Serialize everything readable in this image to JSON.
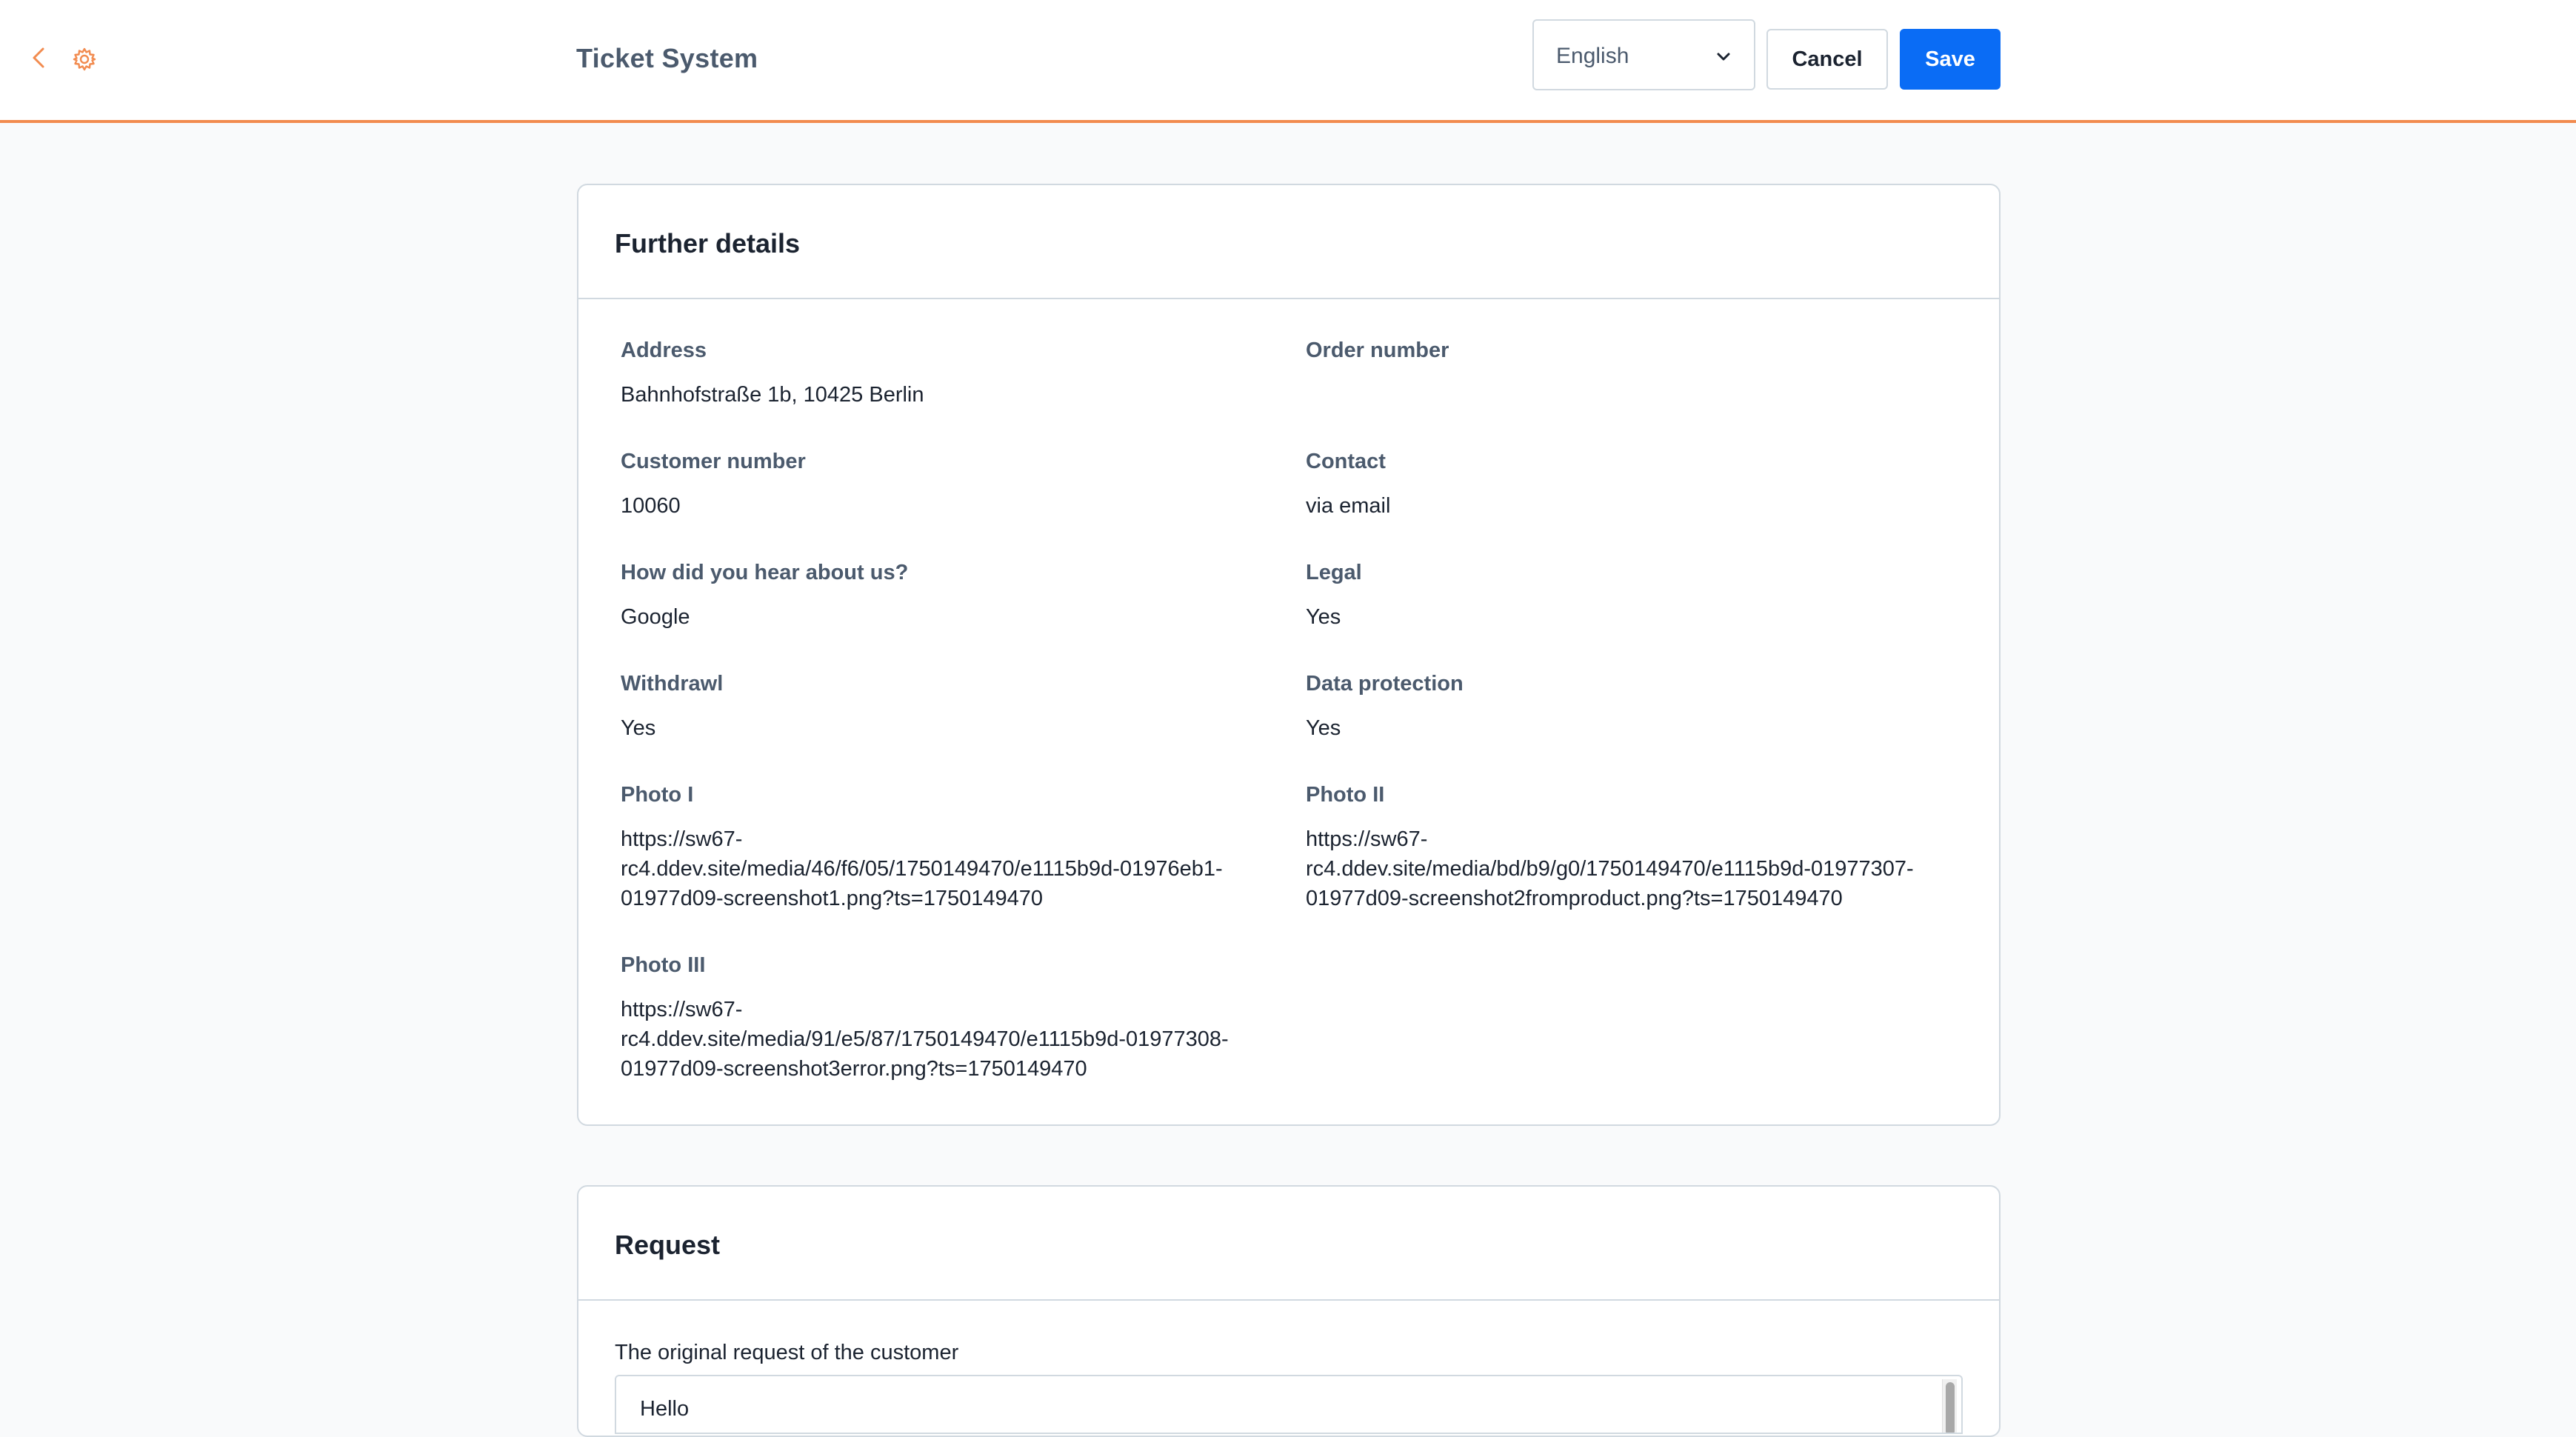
{
  "header": {
    "title": "Ticket System",
    "language": "English",
    "cancel_label": "Cancel",
    "save_label": "Save"
  },
  "colors": {
    "accent": "#f28b4f",
    "primary_button": "#0a6cf5",
    "label_text": "#4b5a6d"
  },
  "further_details": {
    "title": "Further details",
    "fields": [
      {
        "label": "Address",
        "value": "Bahnhofstraße 1b, 10425 Berlin"
      },
      {
        "label": "Order number",
        "value": ""
      },
      {
        "label": "Customer number",
        "value": "10060"
      },
      {
        "label": "Contact",
        "value": "via email"
      },
      {
        "label": "How did you hear about us?",
        "value": "Google"
      },
      {
        "label": "Legal",
        "value": "Yes"
      },
      {
        "label": "Withdrawl",
        "value": "Yes"
      },
      {
        "label": "Data protection",
        "value": "Yes"
      },
      {
        "label": "Photo I",
        "value": "https://sw67-\nrc4.ddev.site/media/46/f6/05/1750149470/e1115b9d-01976eb1-\n01977d09-screenshot1.png?ts=1750149470"
      },
      {
        "label": "Photo II",
        "value": "https://sw67-\nrc4.ddev.site/media/bd/b9/g0/1750149470/e1115b9d-01977307-\n01977d09-screenshot2fromproduct.png?ts=1750149470"
      },
      {
        "label": "Photo III",
        "value": "https://sw67-\nrc4.ddev.site/media/91/e5/87/1750149470/e1115b9d-01977308-\n01977d09-screenshot3error.png?ts=1750149470"
      }
    ]
  },
  "request": {
    "title": "Request",
    "field_label": "The original request of the customer",
    "text": "Hello"
  }
}
